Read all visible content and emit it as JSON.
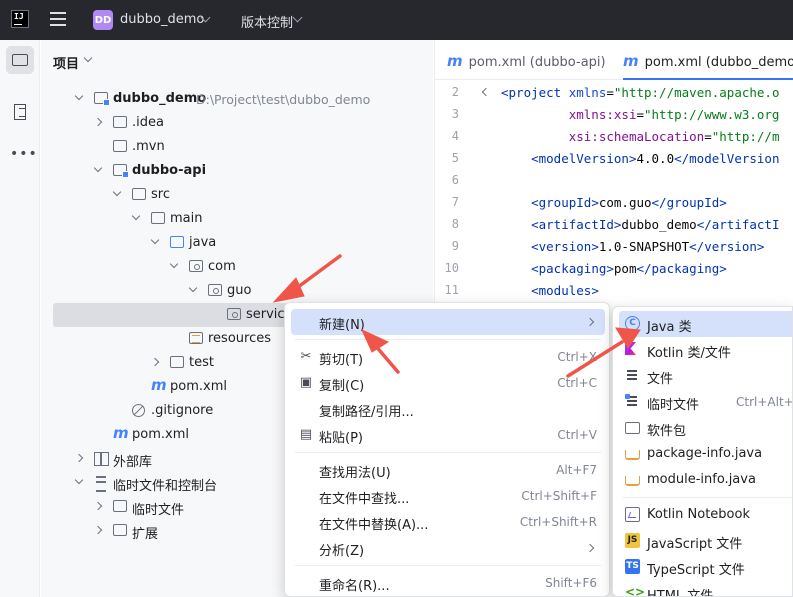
{
  "titlebar": {
    "project_badge": "DD",
    "project_name": "dubbo_demo",
    "vcs_label": "版本控制"
  },
  "panel": {
    "title": "项目"
  },
  "tree": [
    {
      "label": "dubbo_demo",
      "path": "D:\\Project\\test\\dubbo_demo",
      "bold": true,
      "arrow": "down",
      "icon": "module-folder"
    },
    {
      "label": ".idea",
      "arrow": "right",
      "icon": "folder"
    },
    {
      "label": ".mvn",
      "arrow": "none",
      "icon": "folder"
    },
    {
      "label": "dubbo-api",
      "bold": true,
      "arrow": "down",
      "icon": "module-folder"
    },
    {
      "label": "src",
      "arrow": "down",
      "icon": "folder"
    },
    {
      "label": "main",
      "arrow": "down",
      "icon": "folder"
    },
    {
      "label": "java",
      "arrow": "down",
      "icon": "source-folder"
    },
    {
      "label": "com",
      "arrow": "down",
      "icon": "package"
    },
    {
      "label": "guo",
      "arrow": "down",
      "icon": "package"
    },
    {
      "label": "service",
      "arrow": "none",
      "icon": "package",
      "selected": true
    },
    {
      "label": "resources",
      "arrow": "none",
      "icon": "resources-folder"
    },
    {
      "label": "test",
      "arrow": "right",
      "icon": "folder"
    },
    {
      "label": "pom.xml",
      "arrow": "none",
      "icon": "maven-file"
    },
    {
      "label": ".gitignore",
      "arrow": "none",
      "icon": "ignore-file"
    },
    {
      "label": "pom.xml",
      "arrow": "none",
      "icon": "maven-file"
    },
    {
      "label": "外部库",
      "arrow": "right",
      "icon": "library"
    },
    {
      "label": "临时文件和控制台",
      "arrow": "down",
      "icon": "scratches"
    },
    {
      "label": "临时文件",
      "arrow": "right",
      "icon": "folder"
    },
    {
      "label": "扩展",
      "arrow": "right",
      "icon": "folder"
    }
  ],
  "tabs": [
    {
      "label": "pom.xml (dubbo-api)",
      "active": false
    },
    {
      "label": "pom.xml (dubbo_demo)",
      "active": true
    }
  ],
  "code_lines": [
    {
      "n": "2",
      "parts": [
        [
          "tag",
          "<project "
        ],
        [
          "attr",
          "xmlns"
        ],
        [
          "txt",
          "="
        ],
        [
          "str",
          "\"http://maven.apache.o"
        ]
      ]
    },
    {
      "n": "3",
      "parts": [
        [
          "txt",
          "         "
        ],
        [
          "ns",
          "xmlns:xsi"
        ],
        [
          "txt",
          "="
        ],
        [
          "str",
          "\"http://www.w3.org"
        ]
      ]
    },
    {
      "n": "4",
      "parts": [
        [
          "txt",
          "         "
        ],
        [
          "ns",
          "xsi:schemaLocation"
        ],
        [
          "txt",
          "="
        ],
        [
          "str",
          "\"http://m"
        ]
      ]
    },
    {
      "n": "5",
      "parts": [
        [
          "txt",
          "    "
        ],
        [
          "tag",
          "<modelVersion>"
        ],
        [
          "txt",
          "4.0.0"
        ],
        [
          "tag",
          "</modelVersion"
        ]
      ]
    },
    {
      "n": "6",
      "parts": []
    },
    {
      "n": "7",
      "parts": [
        [
          "txt",
          "    "
        ],
        [
          "tag",
          "<groupId>"
        ],
        [
          "txt",
          "com.guo"
        ],
        [
          "tag",
          "</groupId>"
        ]
      ]
    },
    {
      "n": "8",
      "parts": [
        [
          "txt",
          "    "
        ],
        [
          "tag",
          "<artifactId>"
        ],
        [
          "txt",
          "dubbo_demo"
        ],
        [
          "tag",
          "</artifactI"
        ]
      ]
    },
    {
      "n": "9",
      "parts": [
        [
          "txt",
          "    "
        ],
        [
          "tag",
          "<version>"
        ],
        [
          "txt",
          "1.0-SNAPSHOT"
        ],
        [
          "tag",
          "</version>"
        ]
      ]
    },
    {
      "n": "10",
      "parts": [
        [
          "txt",
          "    "
        ],
        [
          "tag",
          "<packaging>"
        ],
        [
          "txt",
          "pom"
        ],
        [
          "tag",
          "</packaging>"
        ]
      ]
    },
    {
      "n": "11",
      "parts": [
        [
          "txt",
          "    "
        ],
        [
          "tag",
          "<modules>"
        ]
      ]
    }
  ],
  "menu": [
    {
      "label": "新建(N)",
      "shortcut": "",
      "submenu": true,
      "highlight": true,
      "icon": ""
    },
    {
      "sep": true
    },
    {
      "label": "剪切(T)",
      "shortcut": "Ctrl+X",
      "icon": "✂"
    },
    {
      "label": "复制(C)",
      "shortcut": "Ctrl+C",
      "icon": "▣"
    },
    {
      "label": "复制路径/引用...",
      "shortcut": "",
      "icon": ""
    },
    {
      "label": "粘贴(P)",
      "shortcut": "Ctrl+V",
      "icon": "▤"
    },
    {
      "sep": true
    },
    {
      "label": "查找用法(U)",
      "shortcut": "Alt+F7",
      "icon": ""
    },
    {
      "label": "在文件中查找...",
      "shortcut": "Ctrl+Shift+F",
      "icon": ""
    },
    {
      "label": "在文件中替换(A)...",
      "shortcut": "Ctrl+Shift+R",
      "icon": ""
    },
    {
      "label": "分析(Z)",
      "shortcut": "",
      "submenu": true,
      "icon": ""
    },
    {
      "sep": true
    },
    {
      "label": "重命名(R)...",
      "shortcut": "Shift+F6",
      "icon": ""
    }
  ],
  "submenu": [
    {
      "label": "Java 类",
      "icon": "class",
      "highlight": true,
      "shortcut": ""
    },
    {
      "label": "Kotlin 类/文件",
      "icon": "kotlin",
      "shortcut": ""
    },
    {
      "label": "文件",
      "icon": "file",
      "shortcut": ""
    },
    {
      "label": "临时文件",
      "icon": "scratch",
      "shortcut": "Ctrl+Alt+S"
    },
    {
      "label": "软件包",
      "icon": "pkg",
      "shortcut": ""
    },
    {
      "label": "package-info.java",
      "icon": "java",
      "shortcut": ""
    },
    {
      "label": "module-info.java",
      "icon": "java",
      "shortcut": ""
    },
    {
      "sep": true
    },
    {
      "label": "Kotlin Notebook",
      "icon": "notebook",
      "shortcut": ""
    },
    {
      "label": "JavaScript 文件",
      "icon": "js",
      "shortcut": ""
    },
    {
      "label": "TypeScript 文件",
      "icon": "ts",
      "shortcut": ""
    },
    {
      "label": "HTML 文件",
      "icon": "html",
      "shortcut": ""
    }
  ],
  "colors": {
    "annotation_arrow": "#f0554a",
    "selection": "#dbdde3",
    "menu_highlight": "#d5e1fb",
    "accent": "#3574f0"
  }
}
